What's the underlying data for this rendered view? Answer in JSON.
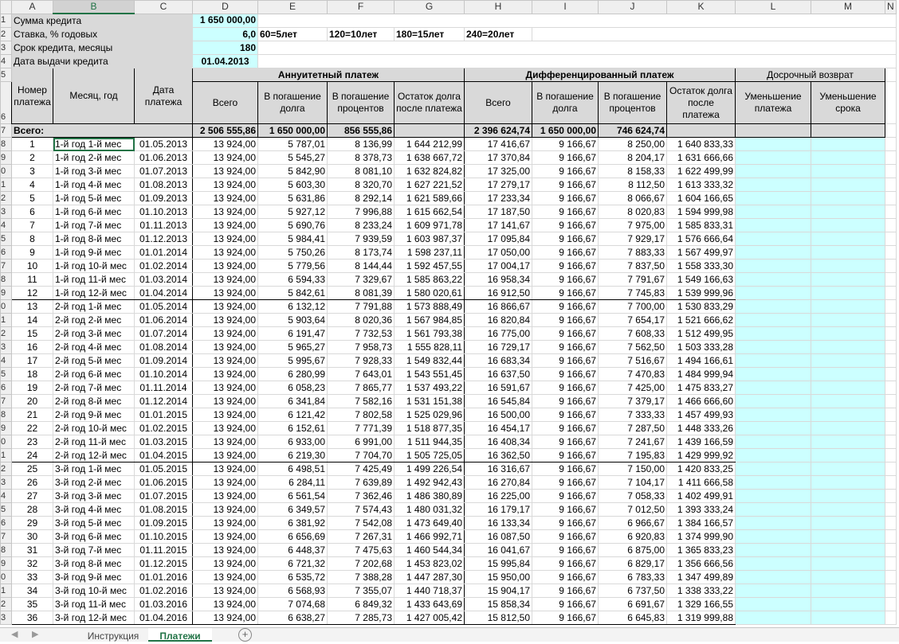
{
  "columns": [
    "A",
    "B",
    "C",
    "D",
    "E",
    "F",
    "G",
    "H",
    "I",
    "J",
    "K",
    "L",
    "M",
    "N"
  ],
  "params": {
    "loan_label": "Сумма кредита",
    "loan_value": "1 650 000,00",
    "rate_label": "Ставка, % годовых",
    "rate_value": "6,0",
    "term_label": "Срок кредита, месяцы",
    "term_value": "180",
    "date_label": "Дата выдачи кредита",
    "date_value": "01.04.2013",
    "term_hints": [
      "60=5лет",
      "120=10лет",
      "180=15лет",
      "240=20лет"
    ]
  },
  "headers": {
    "payment_number": "Номер платежа",
    "month_year": "Месяц, год",
    "payment_date": "Дата платежа",
    "annuity_title": "Аннуитетный платеж",
    "diff_title": "Дифференцированный платеж",
    "early_title": "Досрочный возврат",
    "total": "Всего",
    "principal_annuity": "В погашение долга",
    "interest": "В погашение процентов",
    "balance_annuity": "Остаток долга после платежа",
    "principal_diff": "В погашение долга",
    "balance_diff": "Остаток долга после платежа",
    "reduce_payment": "Уменьшение платежа",
    "reduce_term": "Уменьшение срока"
  },
  "totals": {
    "label": "Всего:",
    "annuity_total": "2 506 555,86",
    "annuity_principal": "1 650 000,00",
    "annuity_interest": "856 555,86",
    "diff_total": "2 396 624,74",
    "diff_principal": "1 650 000,00",
    "diff_interest": "746 624,74"
  },
  "rows": [
    [
      "1",
      "1-й год 1-й мес",
      "01.05.2013",
      "13 924,00",
      "5 787,01",
      "8 136,99",
      "1 644 212,99",
      "17 416,67",
      "9 166,67",
      "8 250,00",
      "1 640 833,33"
    ],
    [
      "2",
      "1-й год 2-й мес",
      "01.06.2013",
      "13 924,00",
      "5 545,27",
      "8 378,73",
      "1 638 667,72",
      "17 370,84",
      "9 166,67",
      "8 204,17",
      "1 631 666,66"
    ],
    [
      "3",
      "1-й год 3-й мес",
      "01.07.2013",
      "13 924,00",
      "5 842,90",
      "8 081,10",
      "1 632 824,82",
      "17 325,00",
      "9 166,67",
      "8 158,33",
      "1 622 499,99"
    ],
    [
      "4",
      "1-й год 4-й мес",
      "01.08.2013",
      "13 924,00",
      "5 603,30",
      "8 320,70",
      "1 627 221,52",
      "17 279,17",
      "9 166,67",
      "8 112,50",
      "1 613 333,32"
    ],
    [
      "5",
      "1-й год 5-й мес",
      "01.09.2013",
      "13 924,00",
      "5 631,86",
      "8 292,14",
      "1 621 589,66",
      "17 233,34",
      "9 166,67",
      "8 066,67",
      "1 604 166,65"
    ],
    [
      "6",
      "1-й год 6-й мес",
      "01.10.2013",
      "13 924,00",
      "5 927,12",
      "7 996,88",
      "1 615 662,54",
      "17 187,50",
      "9 166,67",
      "8 020,83",
      "1 594 999,98"
    ],
    [
      "7",
      "1-й год 7-й мес",
      "01.11.2013",
      "13 924,00",
      "5 690,76",
      "8 233,24",
      "1 609 971,78",
      "17 141,67",
      "9 166,67",
      "7 975,00",
      "1 585 833,31"
    ],
    [
      "8",
      "1-й год 8-й мес",
      "01.12.2013",
      "13 924,00",
      "5 984,41",
      "7 939,59",
      "1 603 987,37",
      "17 095,84",
      "9 166,67",
      "7 929,17",
      "1 576 666,64"
    ],
    [
      "9",
      "1-й год 9-й мес",
      "01.01.2014",
      "13 924,00",
      "5 750,26",
      "8 173,74",
      "1 598 237,11",
      "17 050,00",
      "9 166,67",
      "7 883,33",
      "1 567 499,97"
    ],
    [
      "10",
      "1-й год 10-й мес",
      "01.02.2014",
      "13 924,00",
      "5 779,56",
      "8 144,44",
      "1 592 457,55",
      "17 004,17",
      "9 166,67",
      "7 837,50",
      "1 558 333,30"
    ],
    [
      "11",
      "1-й год 11-й мес",
      "01.03.2014",
      "13 924,00",
      "6 594,33",
      "7 329,67",
      "1 585 863,22",
      "16 958,34",
      "9 166,67",
      "7 791,67",
      "1 549 166,63"
    ],
    [
      "12",
      "1-й год 12-й мес",
      "01.04.2014",
      "13 924,00",
      "5 842,61",
      "8 081,39",
      "1 580 020,61",
      "16 912,50",
      "9 166,67",
      "7 745,83",
      "1 539 999,96"
    ],
    [
      "13",
      "2-й год 1-й мес",
      "01.05.2014",
      "13 924,00",
      "6 132,12",
      "7 791,88",
      "1 573 888,49",
      "16 866,67",
      "9 166,67",
      "7 700,00",
      "1 530 833,29"
    ],
    [
      "14",
      "2-й год 2-й мес",
      "01.06.2014",
      "13 924,00",
      "5 903,64",
      "8 020,36",
      "1 567 984,85",
      "16 820,84",
      "9 166,67",
      "7 654,17",
      "1 521 666,62"
    ],
    [
      "15",
      "2-й год 3-й мес",
      "01.07.2014",
      "13 924,00",
      "6 191,47",
      "7 732,53",
      "1 561 793,38",
      "16 775,00",
      "9 166,67",
      "7 608,33",
      "1 512 499,95"
    ],
    [
      "16",
      "2-й год 4-й мес",
      "01.08.2014",
      "13 924,00",
      "5 965,27",
      "7 958,73",
      "1 555 828,11",
      "16 729,17",
      "9 166,67",
      "7 562,50",
      "1 503 333,28"
    ],
    [
      "17",
      "2-й год 5-й мес",
      "01.09.2014",
      "13 924,00",
      "5 995,67",
      "7 928,33",
      "1 549 832,44",
      "16 683,34",
      "9 166,67",
      "7 516,67",
      "1 494 166,61"
    ],
    [
      "18",
      "2-й год 6-й мес",
      "01.10.2014",
      "13 924,00",
      "6 280,99",
      "7 643,01",
      "1 543 551,45",
      "16 637,50",
      "9 166,67",
      "7 470,83",
      "1 484 999,94"
    ],
    [
      "19",
      "2-й год 7-й мес",
      "01.11.2014",
      "13 924,00",
      "6 058,23",
      "7 865,77",
      "1 537 493,22",
      "16 591,67",
      "9 166,67",
      "7 425,00",
      "1 475 833,27"
    ],
    [
      "20",
      "2-й год 8-й мес",
      "01.12.2014",
      "13 924,00",
      "6 341,84",
      "7 582,16",
      "1 531 151,38",
      "16 545,84",
      "9 166,67",
      "7 379,17",
      "1 466 666,60"
    ],
    [
      "21",
      "2-й год 9-й мес",
      "01.01.2015",
      "13 924,00",
      "6 121,42",
      "7 802,58",
      "1 525 029,96",
      "16 500,00",
      "9 166,67",
      "7 333,33",
      "1 457 499,93"
    ],
    [
      "22",
      "2-й год 10-й мес",
      "01.02.2015",
      "13 924,00",
      "6 152,61",
      "7 771,39",
      "1 518 877,35",
      "16 454,17",
      "9 166,67",
      "7 287,50",
      "1 448 333,26"
    ],
    [
      "23",
      "2-й год 11-й мес",
      "01.03.2015",
      "13 924,00",
      "6 933,00",
      "6 991,00",
      "1 511 944,35",
      "16 408,34",
      "9 166,67",
      "7 241,67",
      "1 439 166,59"
    ],
    [
      "24",
      "2-й год 12-й мес",
      "01.04.2015",
      "13 924,00",
      "6 219,30",
      "7 704,70",
      "1 505 725,05",
      "16 362,50",
      "9 166,67",
      "7 195,83",
      "1 429 999,92"
    ],
    [
      "25",
      "3-й год 1-й мес",
      "01.05.2015",
      "13 924,00",
      "6 498,51",
      "7 425,49",
      "1 499 226,54",
      "16 316,67",
      "9 166,67",
      "7 150,00",
      "1 420 833,25"
    ],
    [
      "26",
      "3-й год 2-й мес",
      "01.06.2015",
      "13 924,00",
      "6 284,11",
      "7 639,89",
      "1 492 942,43",
      "16 270,84",
      "9 166,67",
      "7 104,17",
      "1 411 666,58"
    ],
    [
      "27",
      "3-й год 3-й мес",
      "01.07.2015",
      "13 924,00",
      "6 561,54",
      "7 362,46",
      "1 486 380,89",
      "16 225,00",
      "9 166,67",
      "7 058,33",
      "1 402 499,91"
    ],
    [
      "28",
      "3-й год 4-й мес",
      "01.08.2015",
      "13 924,00",
      "6 349,57",
      "7 574,43",
      "1 480 031,32",
      "16 179,17",
      "9 166,67",
      "7 012,50",
      "1 393 333,24"
    ],
    [
      "29",
      "3-й год 5-й мес",
      "01.09.2015",
      "13 924,00",
      "6 381,92",
      "7 542,08",
      "1 473 649,40",
      "16 133,34",
      "9 166,67",
      "6 966,67",
      "1 384 166,57"
    ],
    [
      "30",
      "3-й год 6-й мес",
      "01.10.2015",
      "13 924,00",
      "6 656,69",
      "7 267,31",
      "1 466 992,71",
      "16 087,50",
      "9 166,67",
      "6 920,83",
      "1 374 999,90"
    ],
    [
      "31",
      "3-й год 7-й мес",
      "01.11.2015",
      "13 924,00",
      "6 448,37",
      "7 475,63",
      "1 460 544,34",
      "16 041,67",
      "9 166,67",
      "6 875,00",
      "1 365 833,23"
    ],
    [
      "32",
      "3-й год 8-й мес",
      "01.12.2015",
      "13 924,00",
      "6 721,32",
      "7 202,68",
      "1 453 823,02",
      "15 995,84",
      "9 166,67",
      "6 829,17",
      "1 356 666,56"
    ],
    [
      "33",
      "3-й год 9-й мес",
      "01.01.2016",
      "13 924,00",
      "6 535,72",
      "7 388,28",
      "1 447 287,30",
      "15 950,00",
      "9 166,67",
      "6 783,33",
      "1 347 499,89"
    ],
    [
      "34",
      "3-й год 10-й мес",
      "01.02.2016",
      "13 924,00",
      "6 568,93",
      "7 355,07",
      "1 440 718,37",
      "15 904,17",
      "9 166,67",
      "6 737,50",
      "1 338 333,22"
    ],
    [
      "35",
      "3-й год 11-й мес",
      "01.03.2016",
      "13 924,00",
      "7 074,68",
      "6 849,32",
      "1 433 643,69",
      "15 858,34",
      "9 166,67",
      "6 691,67",
      "1 329 166,55"
    ],
    [
      "36",
      "3-й год 12-й мес",
      "01.04.2016",
      "13 924,00",
      "6 638,27",
      "7 285,73",
      "1 427 005,42",
      "15 812,50",
      "9 166,67",
      "6 645,83",
      "1 319 999,88"
    ]
  ],
  "tabs": {
    "instruction": "Инструкция",
    "payments": "Платежи",
    "add": "+"
  },
  "colors": {
    "accent": "#217346",
    "cyan_fill": "#ccffff",
    "gray_fill": "#d9d9d9"
  }
}
